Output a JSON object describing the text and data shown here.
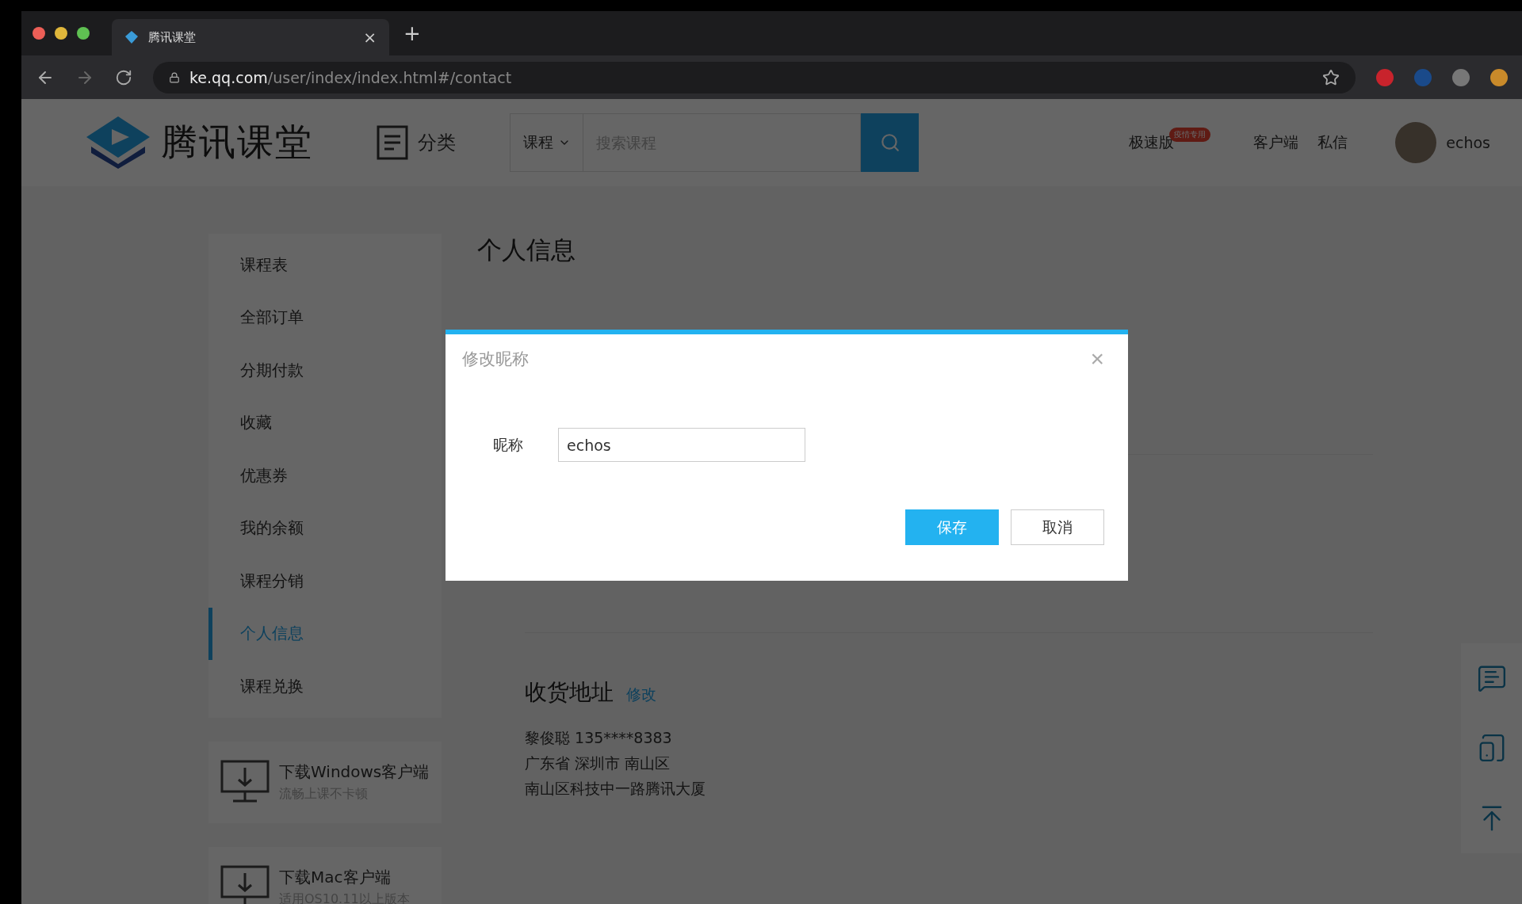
{
  "browser": {
    "tab": {
      "title": "腾讯课堂",
      "close": "×",
      "new_tab": "+"
    },
    "url": {
      "host": "ke.qq.com",
      "path": "/user/index/index.html#/contact"
    }
  },
  "header": {
    "logo_text": "腾讯课堂",
    "category": "分类",
    "search": {
      "scope": "课程",
      "placeholder": "搜索课程"
    },
    "nav": [
      {
        "label": "极速版",
        "badge": "疫情专用"
      },
      {
        "label": "客户端"
      },
      {
        "label": "私信"
      }
    ],
    "user": {
      "name": "echos"
    }
  },
  "sidebar": {
    "items": [
      {
        "label": "课程表",
        "selected": false
      },
      {
        "label": "全部订单",
        "selected": false
      },
      {
        "label": "分期付款",
        "selected": false
      },
      {
        "label": "收藏",
        "selected": false
      },
      {
        "label": "优惠券",
        "selected": false
      },
      {
        "label": "我的余额",
        "selected": false
      },
      {
        "label": "课程分销",
        "selected": false
      },
      {
        "label": "个人信息",
        "selected": true
      },
      {
        "label": "课程兑换",
        "selected": false
      }
    ],
    "downloads": [
      {
        "title": "下载Windows客户端",
        "subtitle": "流畅上课不卡顿"
      },
      {
        "title": "下载Mac客户端",
        "subtitle": "适用OS10.11以上版本"
      }
    ]
  },
  "main": {
    "title": "个人信息",
    "address": {
      "title": "收货地址",
      "edit": "修改",
      "lines": [
        "黎俊聪 135****8383",
        "广东省 深圳市 南山区",
        "南山区科技中一路腾讯大厦"
      ]
    }
  },
  "dialog": {
    "title": "修改昵称",
    "close": "×",
    "field": {
      "label": "昵称",
      "value": "echos"
    },
    "buttons": [
      {
        "label": "保存",
        "kind": "primary"
      },
      {
        "label": "取消",
        "kind": "default"
      }
    ]
  }
}
